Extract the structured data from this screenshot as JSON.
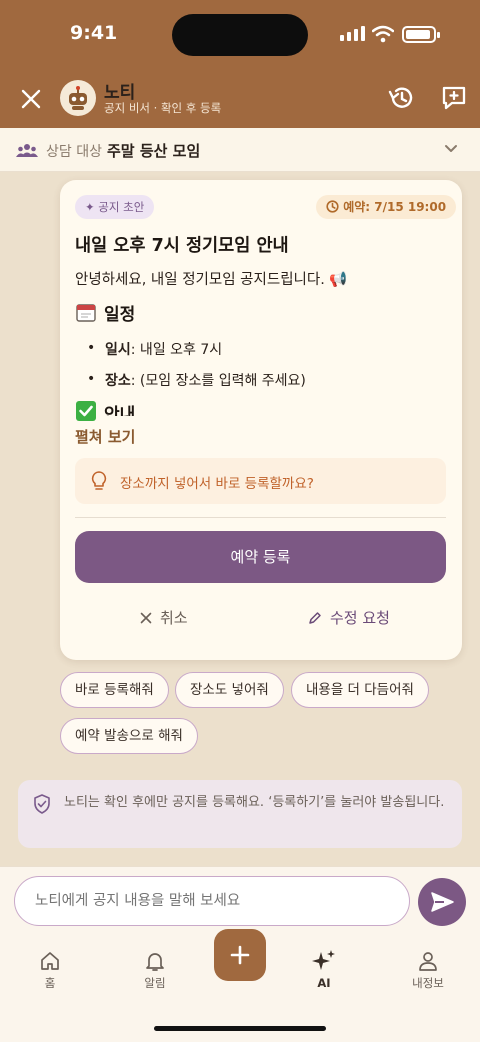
{
  "status": {
    "time": "9:41"
  },
  "header": {
    "title": "노티",
    "subtitle": "공지 비서 · 확인 후 등록",
    "close_icon": "close-icon",
    "history_icon": "history-icon",
    "new_chat_icon": "new-chat-icon"
  },
  "context": {
    "label": "상담 대상",
    "value": "주말 등산 모임"
  },
  "card": {
    "draft_tag": "공지 초안",
    "schedule_tag": "예약: 7/15 19:00",
    "title": "내일 오후 7시 정기모임 안내",
    "greeting": "안녕하세요, 내일 정기모임 공지드립니다. 📢",
    "section1": "일정",
    "bullets": [
      {
        "key": "일시",
        "value": ": 내일 오후 7시"
      },
      {
        "key": "장소",
        "value": ": (모임 장소를 입력해 주세요)"
      }
    ],
    "section2": "안내",
    "expand": "펼쳐 보기",
    "suggestion": "장소까지 넣어서 바로 등록할까요?",
    "primary_button": "예약 등록",
    "cancel_button": "취소",
    "edit_button": "수정 요청"
  },
  "chips": [
    "바로 등록해줘",
    "장소도 넣어줘",
    "내용을 더 다듬어줘",
    "예약 발송으로 해줘"
  ],
  "notice": "노티는 확인 후에만 공지를 등록해요. ‘등록하기’를 눌러야 발송됩니다.",
  "input": {
    "placeholder": "노티에게 공지 내용을 말해 보세요"
  },
  "tabs": [
    {
      "label": "홈",
      "icon": "home-icon"
    },
    {
      "label": "알림",
      "icon": "bell-icon"
    },
    {
      "label": "",
      "icon": "plus-icon"
    },
    {
      "label": "AI",
      "icon": "sparkle-icon"
    },
    {
      "label": "내정보",
      "icon": "person-icon"
    }
  ],
  "colors": {
    "header": "#a0693f",
    "accent": "#7c5884",
    "background": "#ece0cc",
    "card": "#fffaef"
  }
}
